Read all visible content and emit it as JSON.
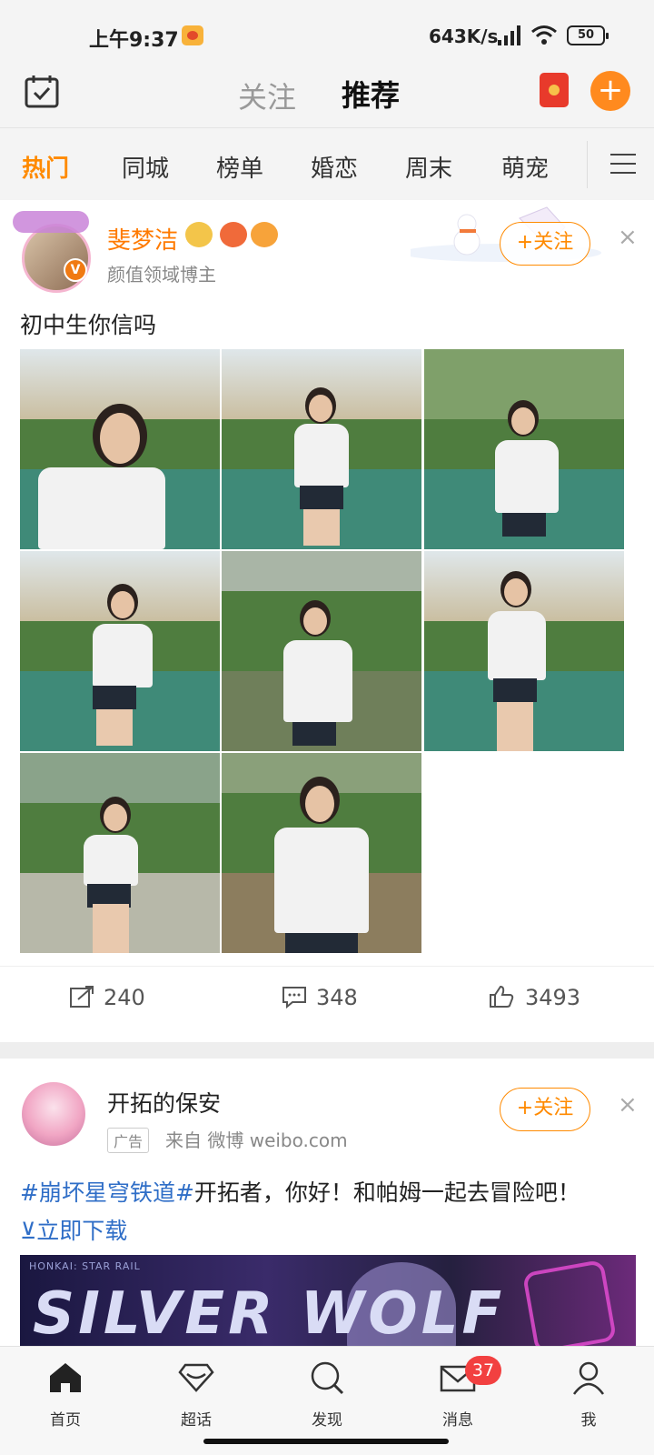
{
  "status_bar": {
    "time": "上午9:37",
    "net_speed": "643K/s",
    "battery": "50"
  },
  "header": {
    "tab_follow": "关注",
    "tab_recommend": "推荐",
    "accent": "#ff8a00"
  },
  "channels": [
    "热门",
    "同城",
    "榜单",
    "婚恋",
    "周末",
    "萌宠"
  ],
  "post1": {
    "username": "斐梦洁",
    "user_desc": "颜值领域博主",
    "follow_label": "+关注",
    "text": "初中生你信吗",
    "photo_count": 8,
    "reposts": "240",
    "comments": "348",
    "likes": "3493"
  },
  "post2": {
    "username": "开拓的保安",
    "ad_tag": "广告",
    "source": "来自 微博 weibo.com",
    "follow_label": "+关注",
    "hashtag": "#崩坏星穹铁道#",
    "text": "开拓者，你好！和帕姆一起去冒险吧！",
    "download": "⊻立即下载",
    "banner_small": "HONKAI: STAR RAIL",
    "banner_title": "SILVER WOLF"
  },
  "bottom_nav": {
    "home": "首页",
    "topics": "超话",
    "discover": "发现",
    "messages": "消息",
    "messages_badge": "37",
    "me": "我"
  }
}
